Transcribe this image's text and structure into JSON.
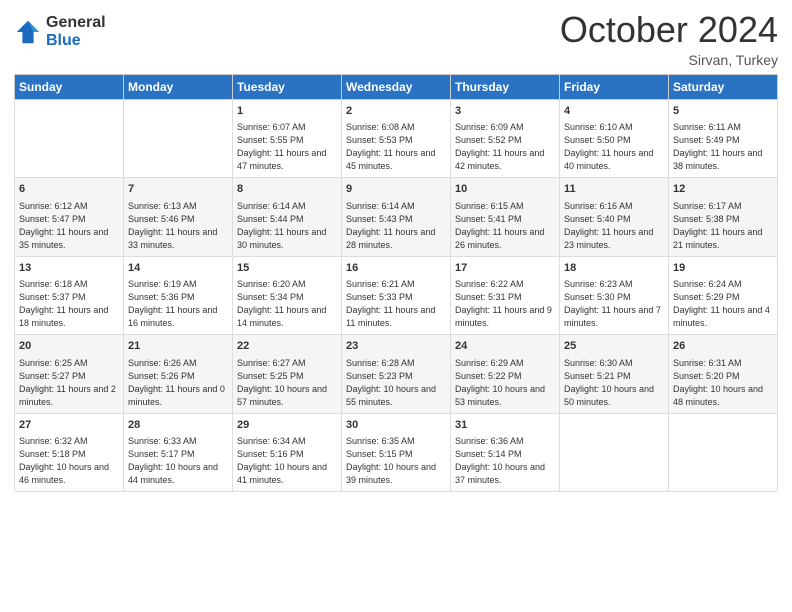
{
  "header": {
    "logo_general": "General",
    "logo_blue": "Blue",
    "month_title": "October 2024",
    "location": "Sirvan, Turkey"
  },
  "columns": [
    "Sunday",
    "Monday",
    "Tuesday",
    "Wednesday",
    "Thursday",
    "Friday",
    "Saturday"
  ],
  "weeks": [
    {
      "days": [
        {
          "num": "",
          "info": ""
        },
        {
          "num": "",
          "info": ""
        },
        {
          "num": "1",
          "info": "Sunrise: 6:07 AM\nSunset: 5:55 PM\nDaylight: 11 hours and 47 minutes."
        },
        {
          "num": "2",
          "info": "Sunrise: 6:08 AM\nSunset: 5:53 PM\nDaylight: 11 hours and 45 minutes."
        },
        {
          "num": "3",
          "info": "Sunrise: 6:09 AM\nSunset: 5:52 PM\nDaylight: 11 hours and 42 minutes."
        },
        {
          "num": "4",
          "info": "Sunrise: 6:10 AM\nSunset: 5:50 PM\nDaylight: 11 hours and 40 minutes."
        },
        {
          "num": "5",
          "info": "Sunrise: 6:11 AM\nSunset: 5:49 PM\nDaylight: 11 hours and 38 minutes."
        }
      ]
    },
    {
      "days": [
        {
          "num": "6",
          "info": "Sunrise: 6:12 AM\nSunset: 5:47 PM\nDaylight: 11 hours and 35 minutes."
        },
        {
          "num": "7",
          "info": "Sunrise: 6:13 AM\nSunset: 5:46 PM\nDaylight: 11 hours and 33 minutes."
        },
        {
          "num": "8",
          "info": "Sunrise: 6:14 AM\nSunset: 5:44 PM\nDaylight: 11 hours and 30 minutes."
        },
        {
          "num": "9",
          "info": "Sunrise: 6:14 AM\nSunset: 5:43 PM\nDaylight: 11 hours and 28 minutes."
        },
        {
          "num": "10",
          "info": "Sunrise: 6:15 AM\nSunset: 5:41 PM\nDaylight: 11 hours and 26 minutes."
        },
        {
          "num": "11",
          "info": "Sunrise: 6:16 AM\nSunset: 5:40 PM\nDaylight: 11 hours and 23 minutes."
        },
        {
          "num": "12",
          "info": "Sunrise: 6:17 AM\nSunset: 5:38 PM\nDaylight: 11 hours and 21 minutes."
        }
      ]
    },
    {
      "days": [
        {
          "num": "13",
          "info": "Sunrise: 6:18 AM\nSunset: 5:37 PM\nDaylight: 11 hours and 18 minutes."
        },
        {
          "num": "14",
          "info": "Sunrise: 6:19 AM\nSunset: 5:36 PM\nDaylight: 11 hours and 16 minutes."
        },
        {
          "num": "15",
          "info": "Sunrise: 6:20 AM\nSunset: 5:34 PM\nDaylight: 11 hours and 14 minutes."
        },
        {
          "num": "16",
          "info": "Sunrise: 6:21 AM\nSunset: 5:33 PM\nDaylight: 11 hours and 11 minutes."
        },
        {
          "num": "17",
          "info": "Sunrise: 6:22 AM\nSunset: 5:31 PM\nDaylight: 11 hours and 9 minutes."
        },
        {
          "num": "18",
          "info": "Sunrise: 6:23 AM\nSunset: 5:30 PM\nDaylight: 11 hours and 7 minutes."
        },
        {
          "num": "19",
          "info": "Sunrise: 6:24 AM\nSunset: 5:29 PM\nDaylight: 11 hours and 4 minutes."
        }
      ]
    },
    {
      "days": [
        {
          "num": "20",
          "info": "Sunrise: 6:25 AM\nSunset: 5:27 PM\nDaylight: 11 hours and 2 minutes."
        },
        {
          "num": "21",
          "info": "Sunrise: 6:26 AM\nSunset: 5:26 PM\nDaylight: 11 hours and 0 minutes."
        },
        {
          "num": "22",
          "info": "Sunrise: 6:27 AM\nSunset: 5:25 PM\nDaylight: 10 hours and 57 minutes."
        },
        {
          "num": "23",
          "info": "Sunrise: 6:28 AM\nSunset: 5:23 PM\nDaylight: 10 hours and 55 minutes."
        },
        {
          "num": "24",
          "info": "Sunrise: 6:29 AM\nSunset: 5:22 PM\nDaylight: 10 hours and 53 minutes."
        },
        {
          "num": "25",
          "info": "Sunrise: 6:30 AM\nSunset: 5:21 PM\nDaylight: 10 hours and 50 minutes."
        },
        {
          "num": "26",
          "info": "Sunrise: 6:31 AM\nSunset: 5:20 PM\nDaylight: 10 hours and 48 minutes."
        }
      ]
    },
    {
      "days": [
        {
          "num": "27",
          "info": "Sunrise: 6:32 AM\nSunset: 5:18 PM\nDaylight: 10 hours and 46 minutes."
        },
        {
          "num": "28",
          "info": "Sunrise: 6:33 AM\nSunset: 5:17 PM\nDaylight: 10 hours and 44 minutes."
        },
        {
          "num": "29",
          "info": "Sunrise: 6:34 AM\nSunset: 5:16 PM\nDaylight: 10 hours and 41 minutes."
        },
        {
          "num": "30",
          "info": "Sunrise: 6:35 AM\nSunset: 5:15 PM\nDaylight: 10 hours and 39 minutes."
        },
        {
          "num": "31",
          "info": "Sunrise: 6:36 AM\nSunset: 5:14 PM\nDaylight: 10 hours and 37 minutes."
        },
        {
          "num": "",
          "info": ""
        },
        {
          "num": "",
          "info": ""
        }
      ]
    }
  ]
}
